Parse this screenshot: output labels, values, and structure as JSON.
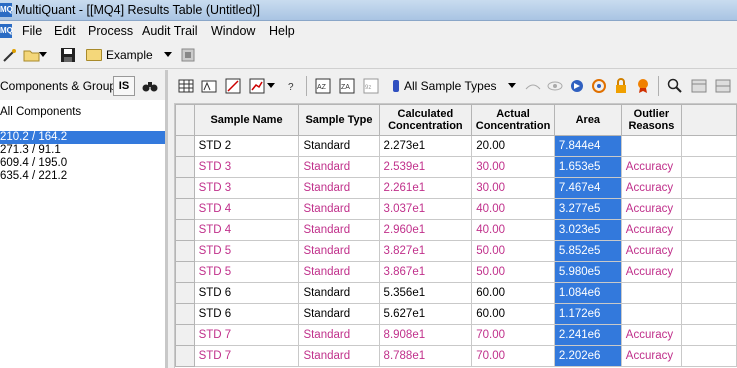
{
  "window": {
    "title": "MultiQuant - [[MQ4] Results Table (Untitled)]",
    "icon": "MQ"
  },
  "menu": {
    "items": [
      "File",
      "Edit",
      "Process",
      "Audit Trail",
      "Window",
      "Help"
    ]
  },
  "toolbar": {
    "project_combo": "Example"
  },
  "left_panel": {
    "header": "Components & Groups",
    "is_button": "IS",
    "items": [
      {
        "label": "All Components",
        "selected": false
      },
      {
        "label": "210.2 / 164.2",
        "selected": true
      },
      {
        "label": "271.3 / 91.1",
        "selected": false
      },
      {
        "label": "609.4 / 195.0",
        "selected": false
      },
      {
        "label": "635.4 / 221.2",
        "selected": false
      }
    ]
  },
  "results_toolbar": {
    "sample_type_filter": "All Sample Types"
  },
  "table": {
    "columns": [
      "Sample Name",
      "Sample Type",
      "Calculated Concentration",
      "Actual Concentration",
      "Area",
      "Outlier Reasons"
    ],
    "rows": [
      {
        "name": "STD 2",
        "type": "Standard",
        "calc": "2.273e1",
        "actual": "20.00",
        "area": "7.844e4",
        "reason": "",
        "outlier": false
      },
      {
        "name": "STD 3",
        "type": "Standard",
        "calc": "2.539e1",
        "actual": "30.00",
        "area": "1.653e5",
        "reason": "Accuracy",
        "outlier": true
      },
      {
        "name": "STD 3",
        "type": "Standard",
        "calc": "2.261e1",
        "actual": "30.00",
        "area": "7.467e4",
        "reason": "Accuracy",
        "outlier": true
      },
      {
        "name": "STD 4",
        "type": "Standard",
        "calc": "3.037e1",
        "actual": "40.00",
        "area": "3.277e5",
        "reason": "Accuracy",
        "outlier": true
      },
      {
        "name": "STD 4",
        "type": "Standard",
        "calc": "2.960e1",
        "actual": "40.00",
        "area": "3.023e5",
        "reason": "Accuracy",
        "outlier": true
      },
      {
        "name": "STD 5",
        "type": "Standard",
        "calc": "3.827e1",
        "actual": "50.00",
        "area": "5.852e5",
        "reason": "Accuracy",
        "outlier": true
      },
      {
        "name": "STD 5",
        "type": "Standard",
        "calc": "3.867e1",
        "actual": "50.00",
        "area": "5.980e5",
        "reason": "Accuracy",
        "outlier": true
      },
      {
        "name": "STD 6",
        "type": "Standard",
        "calc": "5.356e1",
        "actual": "60.00",
        "area": "1.084e6",
        "reason": "",
        "outlier": false
      },
      {
        "name": "STD 6",
        "type": "Standard",
        "calc": "5.627e1",
        "actual": "60.00",
        "area": "1.172e6",
        "reason": "",
        "outlier": false
      },
      {
        "name": "STD 7",
        "type": "Standard",
        "calc": "8.908e1",
        "actual": "70.00",
        "area": "2.241e6",
        "reason": "Accuracy",
        "outlier": true
      },
      {
        "name": "STD 7",
        "type": "Standard",
        "calc": "8.788e1",
        "actual": "70.00",
        "area": "2.202e6",
        "reason": "Accuracy",
        "outlier": true
      }
    ]
  },
  "colors": {
    "outlier_text": "#c0308b",
    "selection": "#3379dc"
  }
}
